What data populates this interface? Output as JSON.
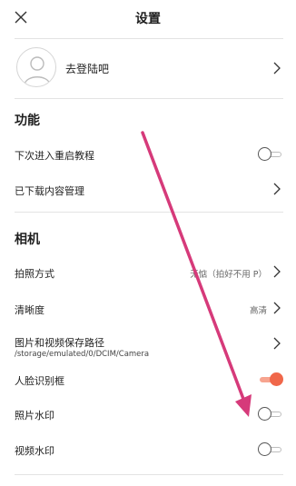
{
  "header": {
    "title": "设置",
    "close_icon": "close-icon"
  },
  "profile": {
    "login_label": "去登陆吧"
  },
  "sections": {
    "features": "功能",
    "camera": "相机"
  },
  "features": {
    "restart_tutorial": "下次进入重启教程",
    "downloads": "已下载内容管理"
  },
  "camera": {
    "shooting_mode": {
      "label": "拍照方式",
      "value": "无惦（拍好不用 P）"
    },
    "resolution": {
      "label": "清晰度",
      "value": "高清"
    },
    "save_path": {
      "label": "图片和视频保存路径",
      "path": "/storage/emulated/0/DCIM/Camera"
    },
    "face_frame": {
      "label": "人脸识别框"
    },
    "photo_watermark": {
      "label": "照片水印"
    },
    "video_watermark": {
      "label": "视频水印"
    }
  },
  "toggles": {
    "restart_tutorial": false,
    "face_frame": true,
    "photo_watermark": false,
    "video_watermark": false
  },
  "colors": {
    "accent": "#f0674a",
    "annotation_arrow": "#d63a7a"
  }
}
